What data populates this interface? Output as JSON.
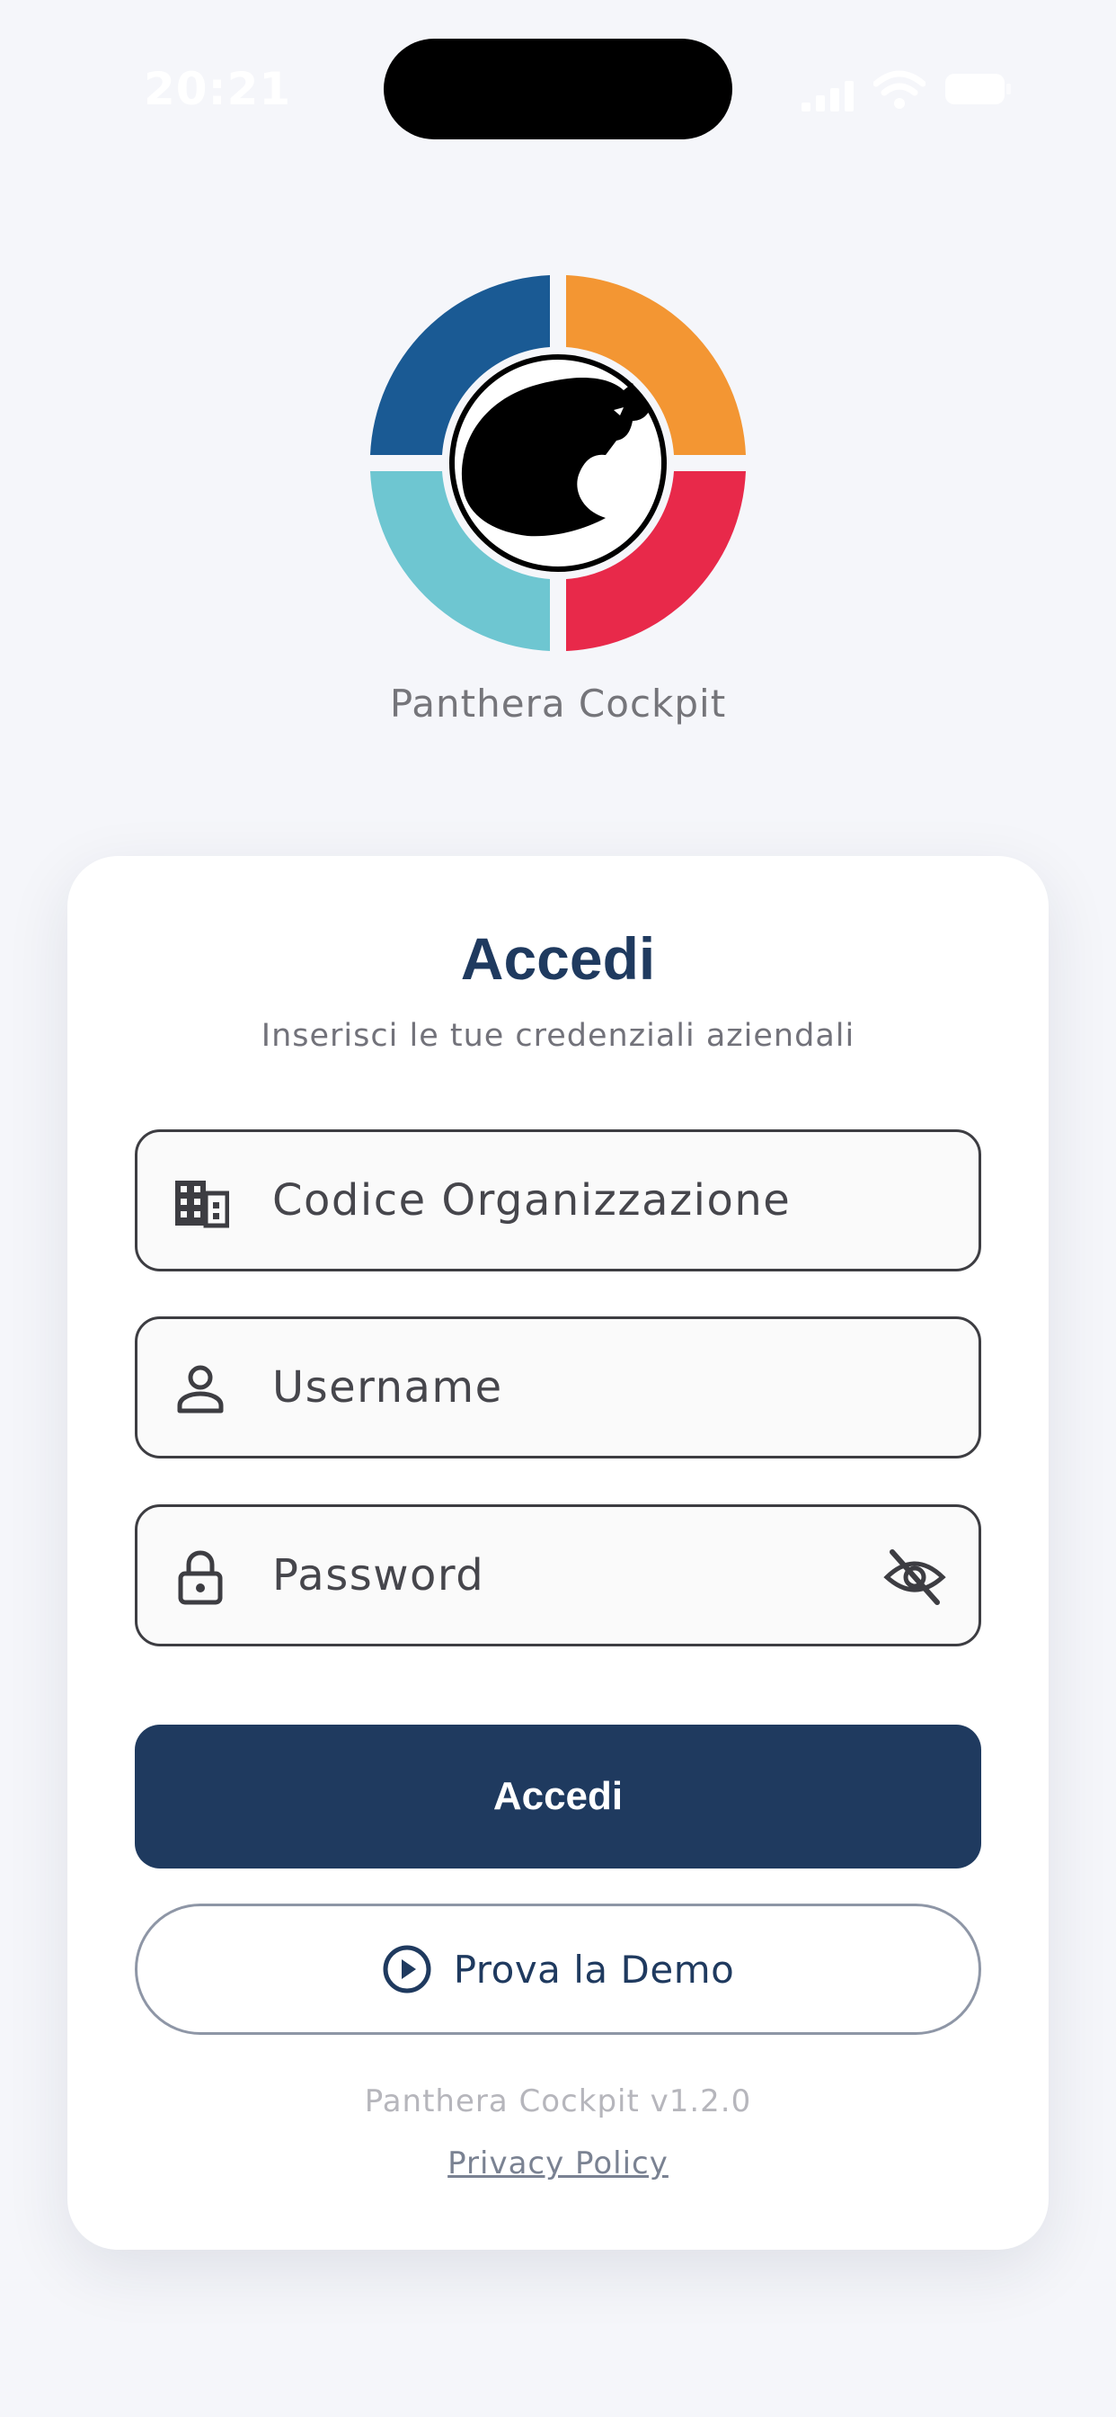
{
  "status_bar": {
    "time": "20:21"
  },
  "app": {
    "name": "Panthera Cockpit",
    "logo_colors": {
      "top_left": "#1a5a94",
      "top_right": "#f39633",
      "bottom_left": "#6ec6d1",
      "bottom_right": "#e8294a"
    }
  },
  "login": {
    "title": "Accedi",
    "subtitle": "Inserisci le tue credenziali aziendali",
    "fields": {
      "organization": {
        "placeholder": "Codice Organizzazione",
        "value": "",
        "icon": "building-icon"
      },
      "username": {
        "placeholder": "Username",
        "value": "",
        "icon": "person-icon"
      },
      "password": {
        "placeholder": "Password",
        "value": "",
        "icon": "lock-icon",
        "toggle_icon": "eye-off-icon"
      }
    },
    "submit_label": "Accedi",
    "demo_label": "Prova la Demo",
    "demo_icon": "play-circle-icon",
    "version": "Panthera Cockpit v1.2.0",
    "privacy_label": "Privacy Policy"
  },
  "colors": {
    "primary": "#1f3a5f",
    "background": "#f5f6fa",
    "card": "#ffffff"
  }
}
